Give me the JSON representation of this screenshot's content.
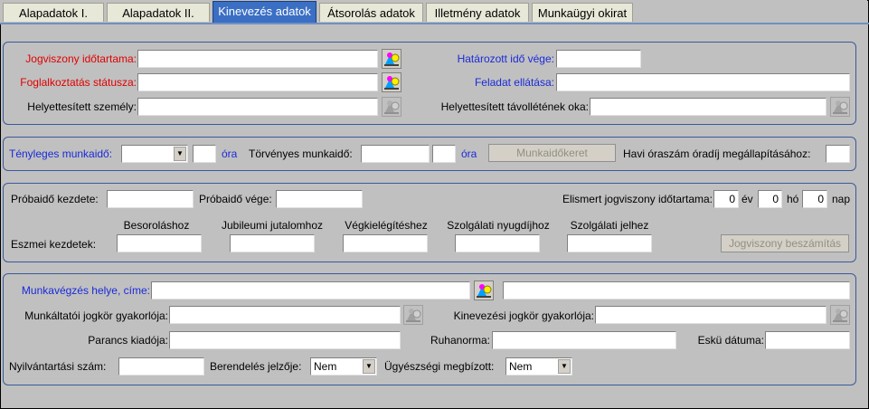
{
  "tabs": [
    "Alapadatok I.",
    "Alapadatok II.",
    "Kinevezés adatok",
    "Átsorolás adatok",
    "Illetmény adatok",
    "Munkaügyi okirat"
  ],
  "g1": {
    "jogviszony_idotartama": "Jogviszony időtartama:",
    "foglalkoztatas_statusza": "Foglalkoztatás státusza:",
    "helyettesitett_szemely": "Helyettesített személy:",
    "hatarozott_ido_vege": "Határozott idő vége:",
    "feladat_ellatasa": "Feladat ellátása:",
    "helyettesitett_tavollet": "Helyettesített távollétének oka:"
  },
  "g2": {
    "tenyleges_munkaido": "Tényleges munkaidő:",
    "ora1": "óra",
    "torvenyes_munkaido": "Törvényes munkaidő:",
    "ora2": "óra",
    "munkaidokeret_button": "Munkaidőkeret",
    "havi_oraszam": "Havi óraszám óradíj megállapításához:"
  },
  "g3": {
    "probaido_kezdete": "Próbaidő kezdete:",
    "probaido_vege": "Próbaidő vége:",
    "elismert": "Elismert jogviszony időtartama:",
    "ev_value": "0",
    "ev": "év",
    "ho_value": "0",
    "ho": "hó",
    "nap_value": "0",
    "nap": "nap",
    "eszmei_kezdetek": "Eszmei kezdetek:",
    "besorolashoz": "Besoroláshoz",
    "jubileumi": "Jubileumi jutalomhoz",
    "vegkielegiteshez": "Végkielégítéshez",
    "szolgalati_nyugdij": "Szolgálati nyugdíjhoz",
    "szolgalati_jelhez": "Szolgálati jelhez",
    "jogviszony_beszamitas": "Jogviszony beszámítás"
  },
  "g4": {
    "munkavegzes_helye": "Munkavégzés helye, címe:",
    "munkaltatoi": "Munkáltatói jogkör gyakorlója:",
    "kinevezesi": "Kinevezési jogkör gyakorlója:",
    "parancs_kiadoja": "Parancs kiadója:",
    "ruhanorma": "Ruhanorma:",
    "esku_datuma": "Eskü dátuma:",
    "nyilvantartasi_szam": "Nyilvántartási szám:",
    "berendeles_jelzoje": "Berendelés jelzője:",
    "berendeles_value": "Nem",
    "ugyeszsegi": "Ügyészségi megbízott:",
    "ugyeszsegi_value": "Nem"
  }
}
